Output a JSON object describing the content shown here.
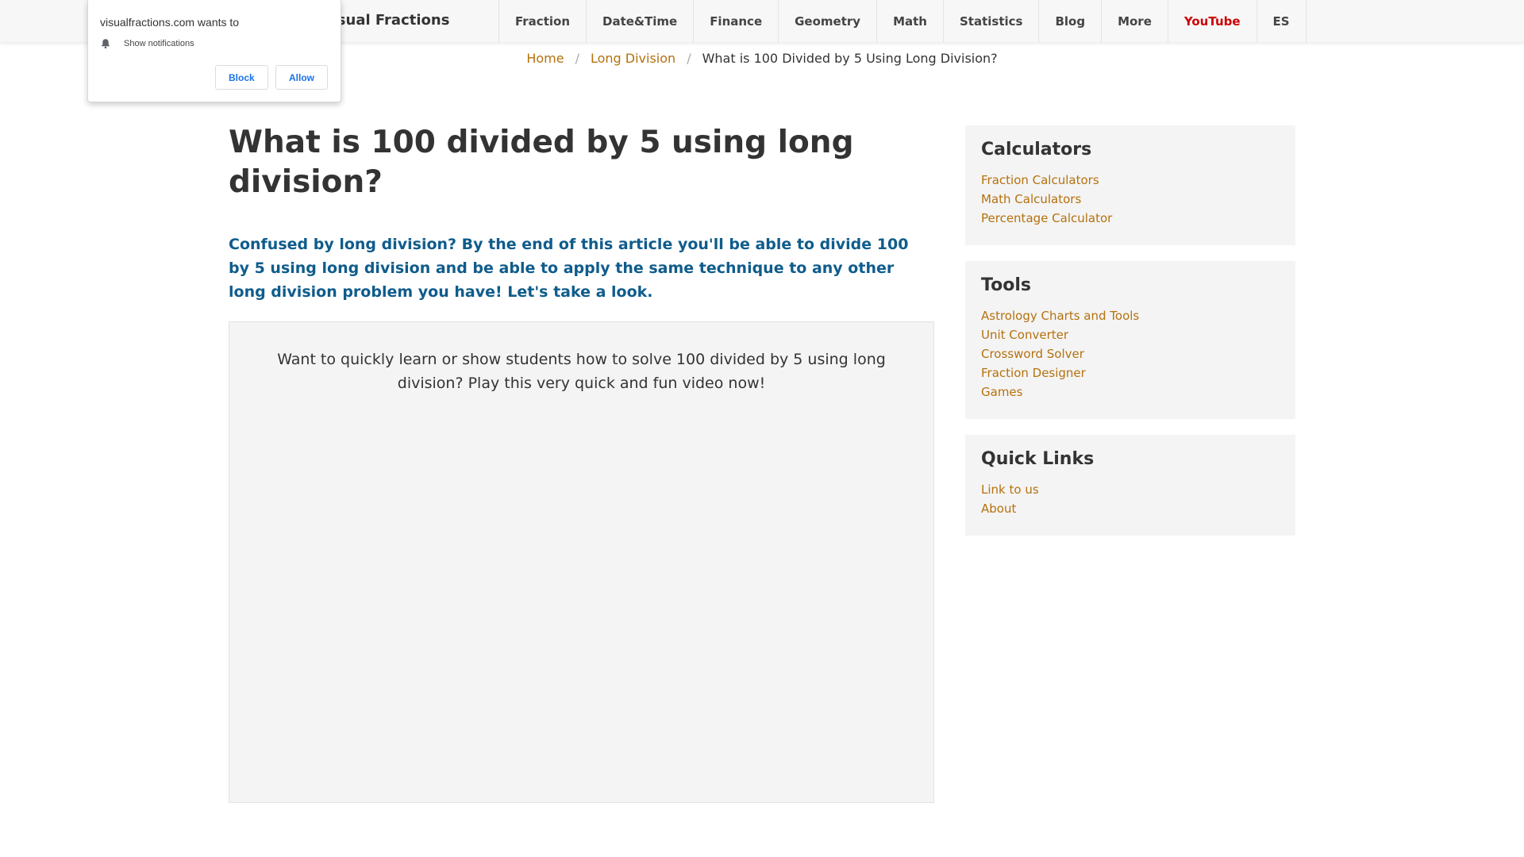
{
  "nav": {
    "brand": "Visual Fractions",
    "items": [
      {
        "label": "Fraction"
      },
      {
        "label": "Date&Time"
      },
      {
        "label": "Finance"
      },
      {
        "label": "Geometry"
      },
      {
        "label": "Math"
      },
      {
        "label": "Statistics"
      },
      {
        "label": "Blog"
      },
      {
        "label": "More"
      },
      {
        "label": "YouTube",
        "color": "#cc0000"
      },
      {
        "label": "ES"
      }
    ]
  },
  "breadcrumb": {
    "home": "Home",
    "section": "Long Division",
    "sep": "/",
    "current": "What is 100 Divided by 5 Using Long Division?"
  },
  "main": {
    "title": "What is 100 divided by 5 using long division?",
    "intro": "Confused by long division? By the end of this article you'll be able to divide 100 by 5 using long division and be able to apply the same technique to any other long division problem you have! Let's take a look.",
    "video_text": "Want to quickly learn or show students how to solve 100 divided by 5 using long division? Play this very quick and fun video now!"
  },
  "sidebar": {
    "calculators": {
      "title": "Calculators",
      "links": [
        "Fraction Calculators",
        "Math Calculators",
        "Percentage Calculator"
      ]
    },
    "tools": {
      "title": "Tools",
      "links": [
        "Astrology Charts and Tools",
        "Unit Converter",
        "Crossword Solver",
        "Fraction Designer",
        "Games"
      ]
    },
    "quick_links": {
      "title": "Quick Links",
      "links": [
        "Link to us",
        "About"
      ]
    }
  },
  "notification": {
    "site": "visualfractions.com wants to",
    "permission": "Show notifications",
    "icon": "bell-icon",
    "block_label": "Block",
    "allow_label": "Allow"
  },
  "colors": {
    "link": "#b5710d",
    "intro": "#0f5c8c",
    "youtube": "#cc0000",
    "notif_button": "#1a73e8"
  }
}
